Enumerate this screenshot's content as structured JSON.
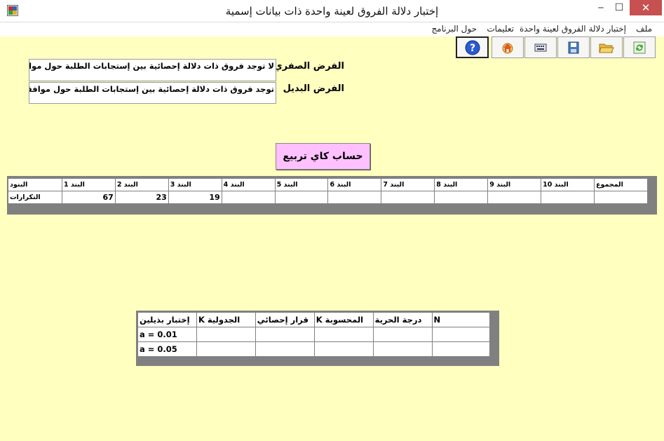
{
  "window": {
    "title": "إختبار دلالة الفروق لعينة واحدة ذات بيانات إسمية",
    "minimize_glyph": "‒",
    "maximize_glyph": "☐",
    "close_glyph": "✕"
  },
  "menu": {
    "file": "ملف",
    "test": "إختبار دلالة الفروق لعينة واحدة",
    "instructions": "تعليمات",
    "about": "حول البرنامج"
  },
  "toolbar": {
    "icons": [
      "refresh-icon",
      "open-folder-icon",
      "save-icon",
      "keyboard-icon",
      "home-icon",
      "help-icon"
    ]
  },
  "hypotheses": {
    "null_label": "الفرض الصفري",
    "null_text": "لا توجد فروق ذات دلالة إحصائية بين إستجابات الطلبة حول موافقتهم",
    "alt_label": "الفرض البديل",
    "alt_text": "توجد فروق ذات دلالة إحصائية بين إستجابات الطلبة حول موافقتهم لـ"
  },
  "calc_button": "حساب كاي تربيع",
  "freq_table": {
    "headers": [
      "البنود",
      "البند 1",
      "البند 2",
      "البند 3",
      "البند 4",
      "البند 5",
      "البند 6",
      "البند 7",
      "البند 8",
      "البند 9",
      "البند 10",
      "المجموع"
    ],
    "row_label": "التكرارات",
    "values": [
      "67",
      "23",
      "19",
      "",
      "",
      "",
      "",
      "",
      "",
      "",
      ""
    ]
  },
  "results_table": {
    "headers": [
      "إختبار بذيلين",
      "K الجدولية",
      "قرار إحصائي",
      "K المحسوبة",
      "درجة الحرية",
      "N"
    ],
    "rows": [
      [
        "a = 0.01",
        "",
        "",
        "",
        "",
        ""
      ],
      [
        "a = 0.05",
        "",
        "",
        "",
        "",
        ""
      ]
    ]
  },
  "colors": {
    "background": "#ffffc0",
    "calc_button": "#ffc0ff",
    "close_button": "#c75050"
  }
}
